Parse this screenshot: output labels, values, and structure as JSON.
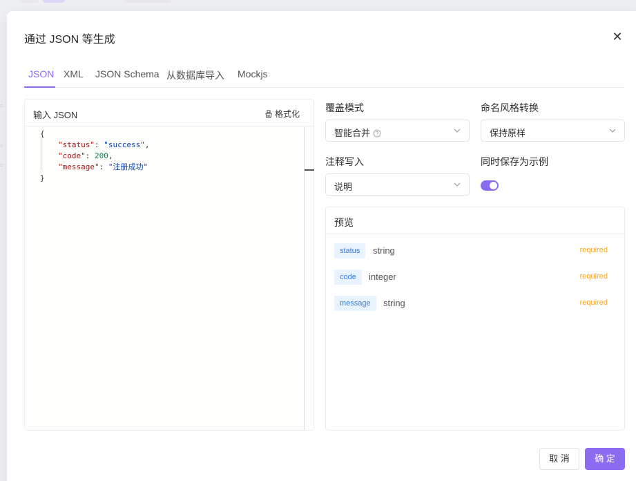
{
  "modal": {
    "title": "通过 JSON 等生成"
  },
  "tabs": [
    {
      "label": "JSON",
      "active": true
    },
    {
      "label": "XML",
      "active": false
    },
    {
      "label": "JSON Schema",
      "active": false
    },
    {
      "label": "从数据库导入",
      "active": false
    },
    {
      "label": "Mockjs",
      "active": false
    }
  ],
  "editor": {
    "title": "输入 JSON",
    "format_label": "格式化",
    "code": {
      "open_brace": "{",
      "close_brace": "}",
      "lines": [
        {
          "key": "\"status\"",
          "sep": ": ",
          "value": "\"success\"",
          "value_type": "string",
          "trail": ","
        },
        {
          "key": "\"code\"",
          "sep": ": ",
          "value": "200",
          "value_type": "number",
          "trail": ","
        },
        {
          "key": "\"message\"",
          "sep": ": ",
          "value": "\"注册成功\"",
          "value_type": "string",
          "trail": ""
        }
      ]
    }
  },
  "options": {
    "override_mode": {
      "label": "覆盖模式",
      "value": "智能合并",
      "has_help_icon": true
    },
    "naming_style": {
      "label": "命名风格转换",
      "value": "保持原样"
    },
    "comment_write": {
      "label": "注释写入",
      "value": "说明"
    },
    "save_as_example": {
      "label": "同时保存为示例",
      "enabled": true
    }
  },
  "preview": {
    "title": "预览",
    "properties": [
      {
        "name": "status",
        "type": "string",
        "required_label": "required"
      },
      {
        "name": "code",
        "type": "integer",
        "required_label": "required"
      },
      {
        "name": "message",
        "type": "string",
        "required_label": "required"
      }
    ]
  },
  "footer": {
    "cancel_label": "取 消",
    "ok_label": "确 定"
  },
  "colors": {
    "accent": "#8b6cf0",
    "tag_bg": "#e8f3ff",
    "tag_text": "#3a7bd5",
    "required": "#f5a623"
  },
  "icons": {
    "close": "close-icon",
    "format": "broom-icon",
    "help": "question-circle-icon",
    "dropdown": "chevron-down-icon"
  }
}
